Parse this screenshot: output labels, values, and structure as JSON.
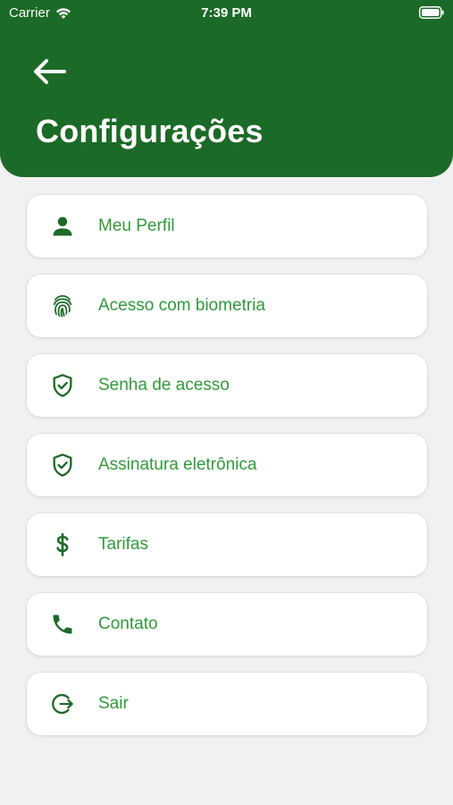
{
  "status_bar": {
    "carrier": "Carrier",
    "time": "7:39 PM"
  },
  "header": {
    "title": "Configurações",
    "back_icon": "arrow-left-icon"
  },
  "colors": {
    "header_bg": "#1c6a27",
    "accent_text": "#2f9a3a",
    "icon": "#1c6a27",
    "background": "#f1f1f1"
  },
  "menu": {
    "items": [
      {
        "label": "Meu Perfil",
        "icon": "person-icon"
      },
      {
        "label": "Acesso com biometria",
        "icon": "fingerprint-icon"
      },
      {
        "label": "Senha de acesso",
        "icon": "shield-check-icon"
      },
      {
        "label": "Assinatura eletrônica",
        "icon": "shield-check-icon"
      },
      {
        "label": "Tarifas",
        "icon": "dollar-icon"
      },
      {
        "label": "Contato",
        "icon": "phone-icon"
      },
      {
        "label": "Sair",
        "icon": "logout-icon"
      }
    ]
  }
}
